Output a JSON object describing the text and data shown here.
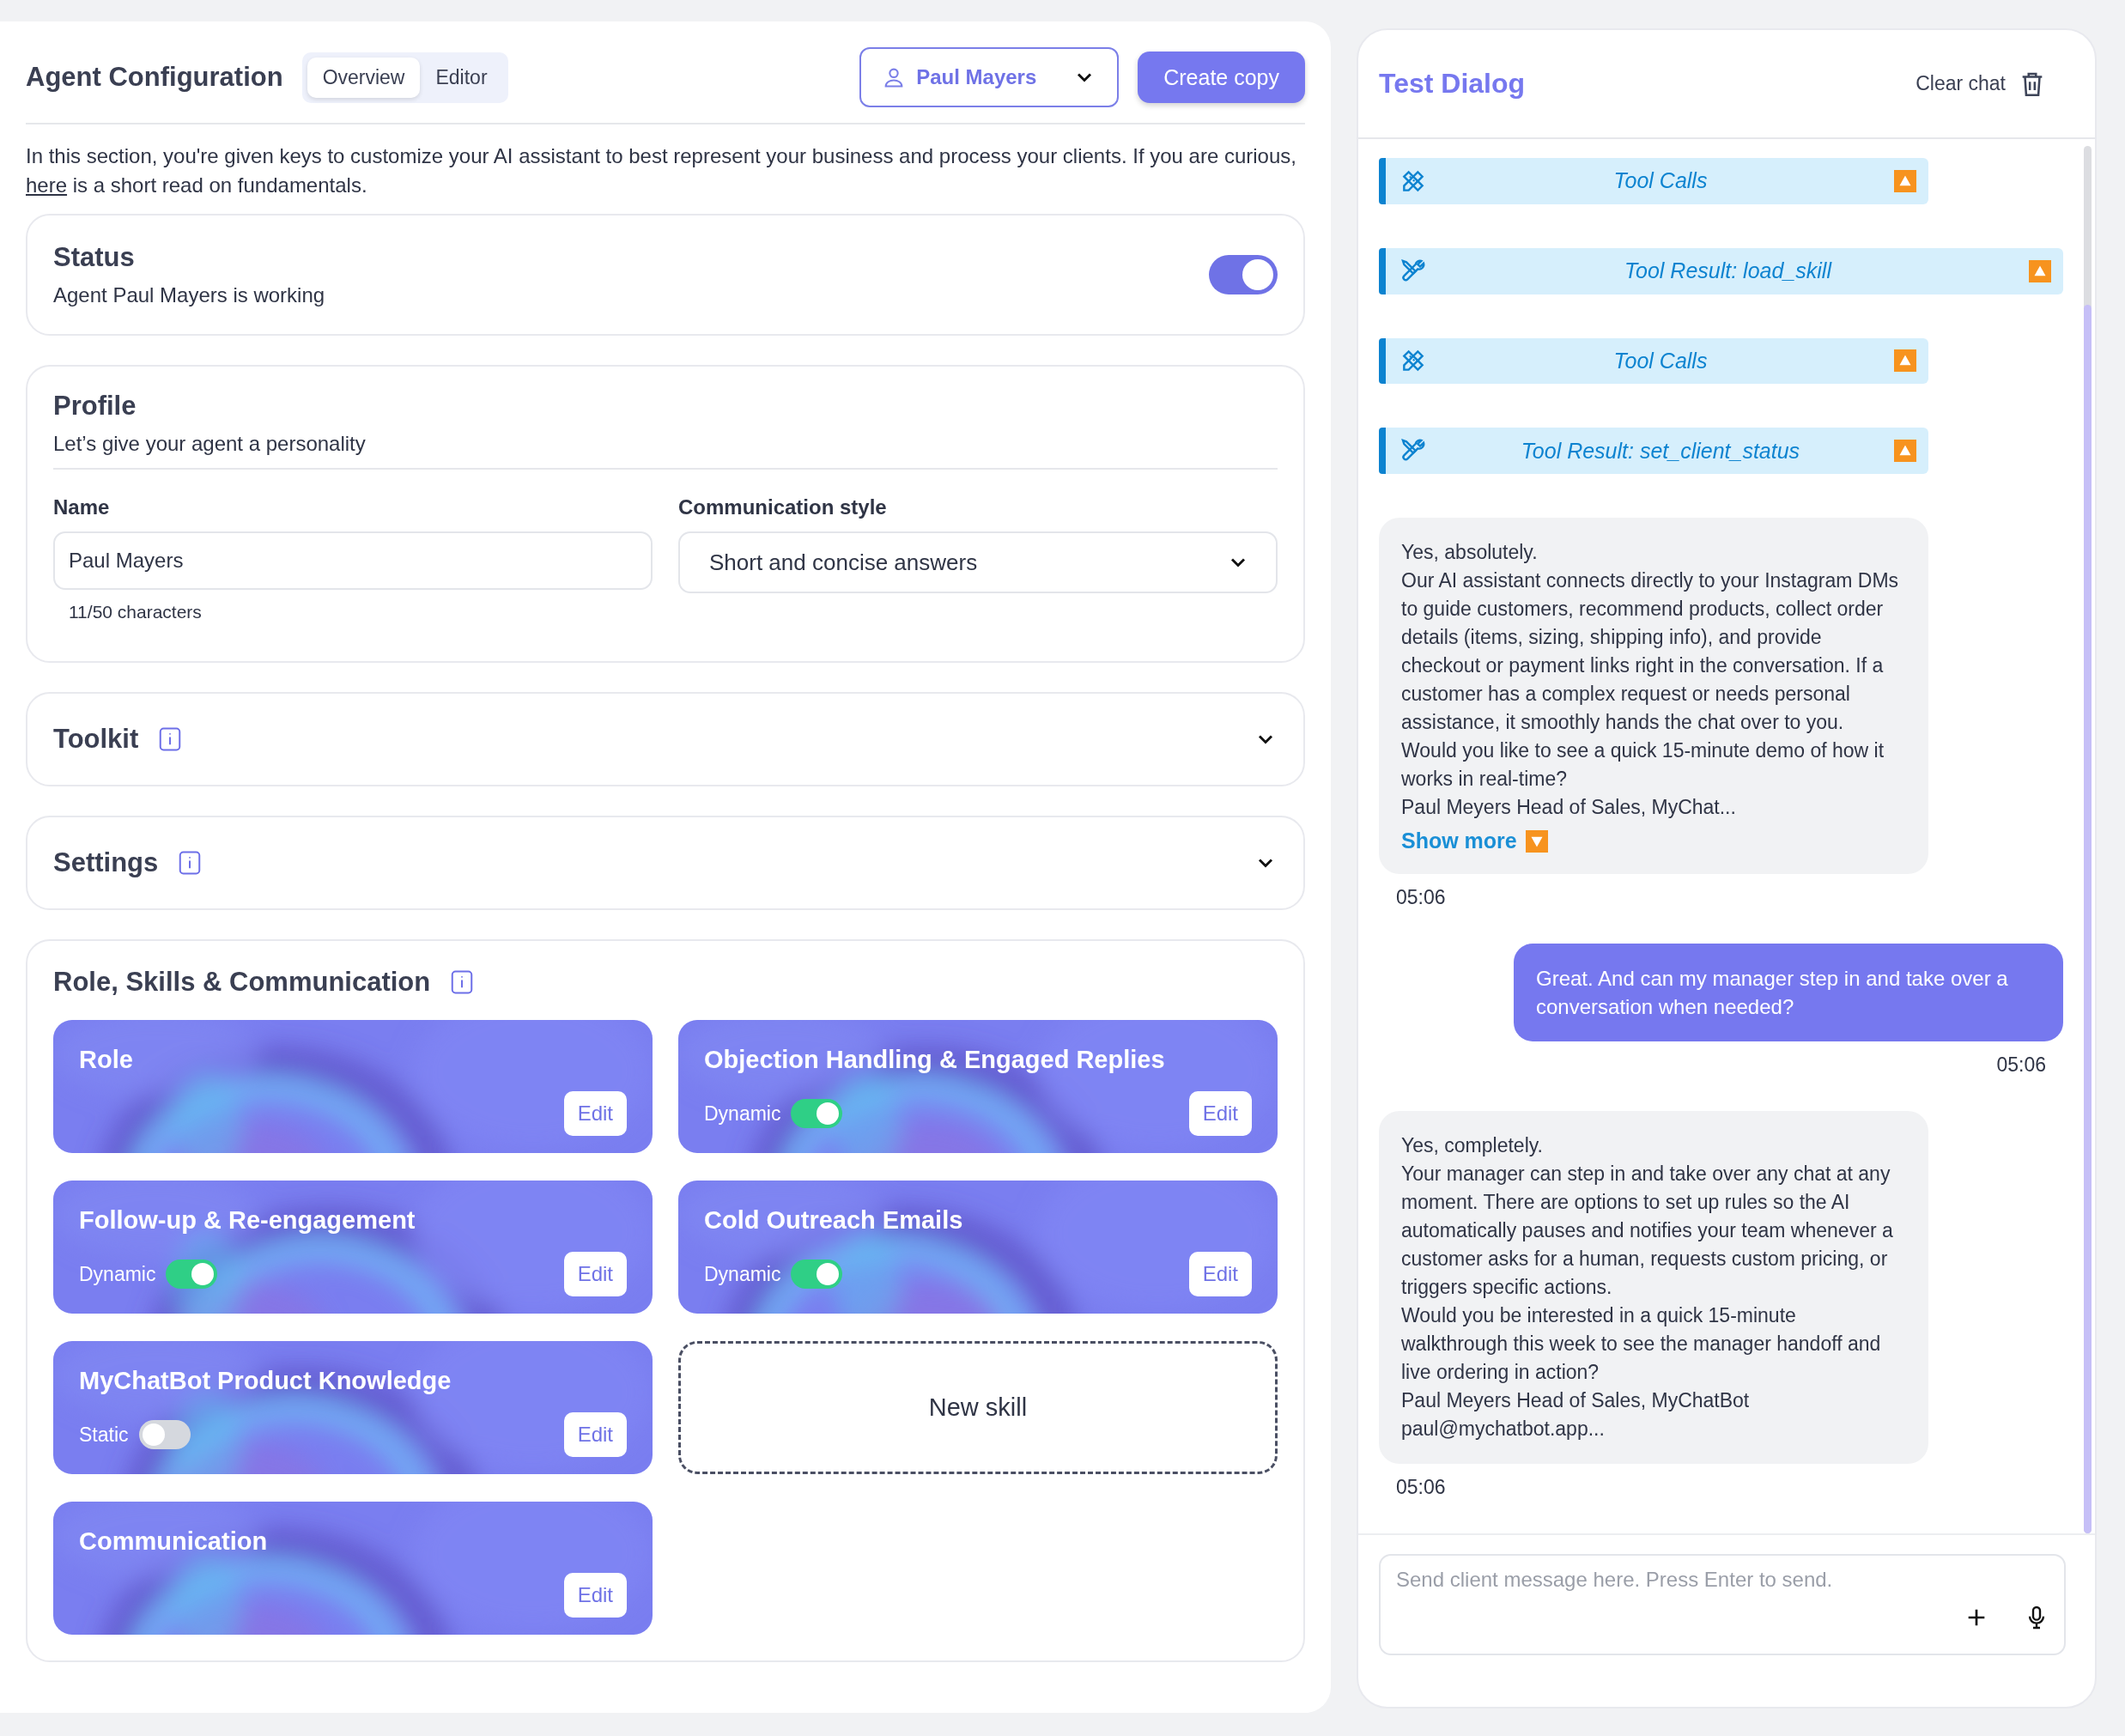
{
  "header": {
    "title": "Agent Configuration",
    "tabs": [
      {
        "label": "Overview",
        "selected": true
      },
      {
        "label": "Editor",
        "selected": false
      }
    ],
    "agent_select": "Paul Mayers",
    "create_button": "Create copy"
  },
  "intro": {
    "before": "In this section, you're given keys to customize your AI assistant to best represent your business and process your clients. If you are curious, ",
    "link": "here",
    "after": " is a short read on fundamentals."
  },
  "status": {
    "title": "Status",
    "subtitle": "Agent Paul Mayers is working",
    "on": true
  },
  "profile": {
    "title": "Profile",
    "subtitle": "Let’s give your agent a personality",
    "name_label": "Name",
    "name_value": "Paul Mayers",
    "counter": "11/50 characters",
    "style_label": "Communication style",
    "style_value": "Short and concise answers"
  },
  "collapsed_sections": [
    {
      "title": "Toolkit",
      "expanded": false
    },
    {
      "title": "Settings",
      "expanded": false
    }
  ],
  "skills": {
    "title": "Role, Skills & Communication",
    "items": [
      {
        "kind": "plain",
        "name": "Role",
        "edit": "Edit"
      },
      {
        "kind": "toggle",
        "name": "Objection Handling & Engaged Replies",
        "mode": "Dynamic",
        "on": true,
        "edit": "Edit"
      },
      {
        "kind": "toggle",
        "name": "Follow-up & Re-engagement",
        "mode": "Dynamic",
        "on": true,
        "edit": "Edit"
      },
      {
        "kind": "toggle",
        "name": "Cold Outreach Emails",
        "mode": "Dynamic",
        "on": true,
        "edit": "Edit"
      },
      {
        "kind": "toggle",
        "name": "MyChatBot Product Knowledge",
        "mode": "Static",
        "on": false,
        "edit": "Edit"
      },
      {
        "kind": "new",
        "name": "New skill"
      },
      {
        "kind": "plain",
        "name": "Communication",
        "edit": "Edit"
      }
    ]
  },
  "test_dialog": {
    "title": "Test Dialog",
    "clear": "Clear chat",
    "messages": [
      {
        "kind": "tool_calls",
        "label": "Tool Calls"
      },
      {
        "kind": "tool_result",
        "label": "Tool Result: load_skill"
      },
      {
        "kind": "tool_calls",
        "label": "Tool Calls"
      },
      {
        "kind": "tool_result",
        "label": "Tool Result: set_client_status"
      },
      {
        "kind": "bot",
        "paragraphs": [
          "Yes, absolutely.",
          "Our AI assistant connects directly to your Instagram DMs to guide customers, recommend products, collect order details (items, sizing, shipping info), and provide checkout or payment links right in the conversation. If a customer has a complex request or needs personal assistance, it smoothly hands the chat over to you.",
          "Would you like to see a quick 15-minute demo of how it works in real-time?",
          "Paul Meyers Head of Sales, MyChat..."
        ],
        "show_more": "Show more",
        "time": "05:06"
      },
      {
        "kind": "user",
        "text": "Great. And can my manager step in and take over a conversation when needed?",
        "time": "05:06"
      },
      {
        "kind": "bot",
        "paragraphs": [
          "Yes, completely.",
          "Your manager can step in and take over any chat at any moment. There are options to set up rules so the AI automatically pauses and notifies your team whenever a customer asks for a human, requests custom pricing, or triggers specific actions.",
          "Would you be interested in a quick 15-minute walkthrough this week to see the manager handoff and live ordering in action?",
          "Paul Meyers Head of Sales, MyChatBot",
          "paul@mychatbot.app..."
        ],
        "time": "05:06"
      }
    ],
    "composer": {
      "placeholder": "Send client message here. Press Enter to send."
    }
  }
}
